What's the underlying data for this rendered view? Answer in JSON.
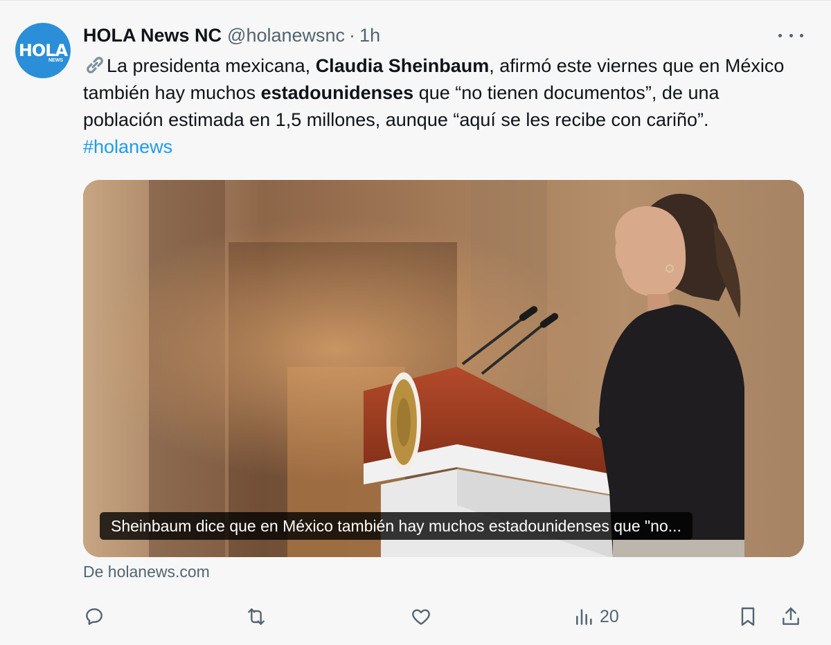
{
  "author": {
    "avatar_text": "HOLA",
    "avatar_sub": "NEWS",
    "name": "HOLA News NC",
    "handle": "@holanewsnc",
    "separator": "·",
    "time": "1h"
  },
  "body": {
    "segment1": "La presidenta mexicana, ",
    "bold1": "Claudia Sheinbaum",
    "segment2": ", afirmó este viernes que en México también hay muchos ",
    "bold2": "estadounidenses",
    "segment3": " que “no tienen documentos”, de una población estimada en 1,5 millones, aunque “aquí se les recibe con cariño”. ",
    "hashtag": "#holanews"
  },
  "card": {
    "caption": "Sheinbaum dice que en México también hay muchos estadounidenses que \"no...",
    "source": "De holanews.com"
  },
  "actions": {
    "views_count": "20"
  },
  "colors": {
    "accent": "#1d9bf0",
    "secondary_text": "#536471",
    "avatar_bg": "#2a8fd8"
  },
  "icons": [
    "link-icon",
    "more-icon",
    "reply-icon",
    "retweet-icon",
    "like-icon",
    "views-icon",
    "bookmark-icon",
    "share-icon"
  ]
}
